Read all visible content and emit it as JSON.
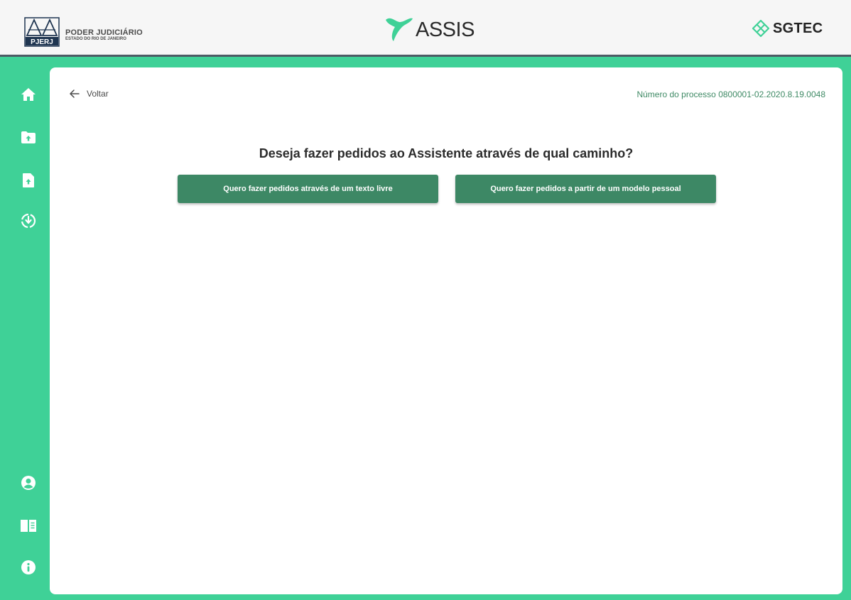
{
  "header": {
    "pjerj_logo_text": "PJERJ",
    "pjerj_title": "PODER JUDICIÁRIO",
    "pjerj_subtitle": "ESTADO DO RIO DE JANEIRO",
    "app_name": "ASSIS",
    "partner_name": "SGTEC"
  },
  "sidebar": {
    "items": [
      {
        "icon": "home-icon"
      },
      {
        "icon": "folder-upload-icon"
      },
      {
        "icon": "file-upload-icon"
      },
      {
        "icon": "download-circle-icon"
      },
      {
        "icon": "user-icon"
      },
      {
        "icon": "book-icon"
      },
      {
        "icon": "info-icon"
      }
    ]
  },
  "main": {
    "back_label": "Voltar",
    "process_number": "Número do processo 0800001-02.2020.8.19.0048",
    "question": "Deseja fazer pedidos ao Assistente através de qual caminho?",
    "option_free_text": "Quero fazer pedidos através de um texto livre",
    "option_personal_model": "Quero fazer pedidos a partir de um modelo pessoal"
  },
  "colors": {
    "accent": "#3fd197",
    "button": "#3d8865",
    "sidebar_icon": "#ffffff",
    "header_border": "#4d5a64"
  }
}
